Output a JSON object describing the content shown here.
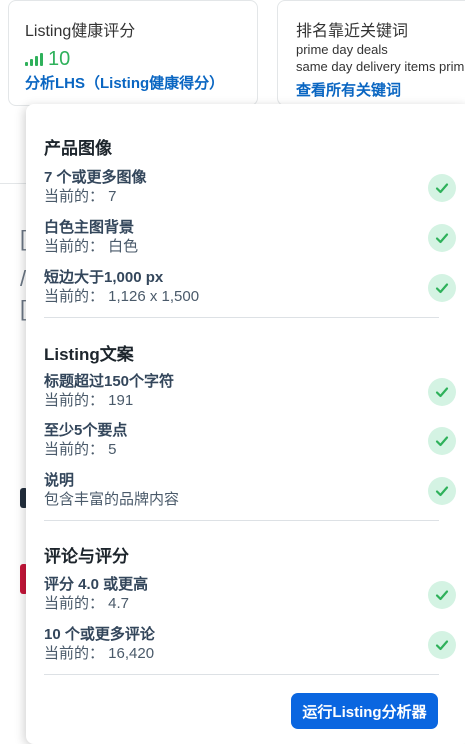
{
  "lhs_card": {
    "title": "Listing健康评分",
    "score": "10",
    "link": "分析LHS（Listing健康得分）"
  },
  "keywords_card": {
    "title": "排名靠近关键词",
    "keywords": [
      "prime day deals",
      "same day delivery items prim"
    ],
    "link": "查看所有关键词"
  },
  "popup": {
    "sections": [
      {
        "title": "产品图像",
        "items": [
          {
            "label": "7 个或更多图像",
            "value": "当前的：  7"
          },
          {
            "label": "白色主图背景",
            "value": "当前的：  白色"
          },
          {
            "label": "短边大于1,000 px",
            "value": "当前的：  1,126 x 1,500"
          }
        ]
      },
      {
        "title": "Listing文案",
        "items": [
          {
            "label": "标题超过150个字符",
            "value": "当前的：  191"
          },
          {
            "label": "至少5个要点",
            "value": "当前的：  5"
          },
          {
            "label": "说明",
            "value": "包含丰富的品牌内容"
          }
        ]
      },
      {
        "title": "评论与评分",
        "items": [
          {
            "label": "评分 4.0 或更高",
            "value": "当前的：  4.7"
          },
          {
            "label": "10 个或更多评论",
            "value": "当前的：  16,420"
          }
        ]
      }
    ],
    "run_button": "运行Listing分析器"
  },
  "colors": {
    "accent": "#0a66e0",
    "score_green": "#2fb15b",
    "check_bg": "#d4f3e3",
    "check_mark": "#2fb15b"
  }
}
